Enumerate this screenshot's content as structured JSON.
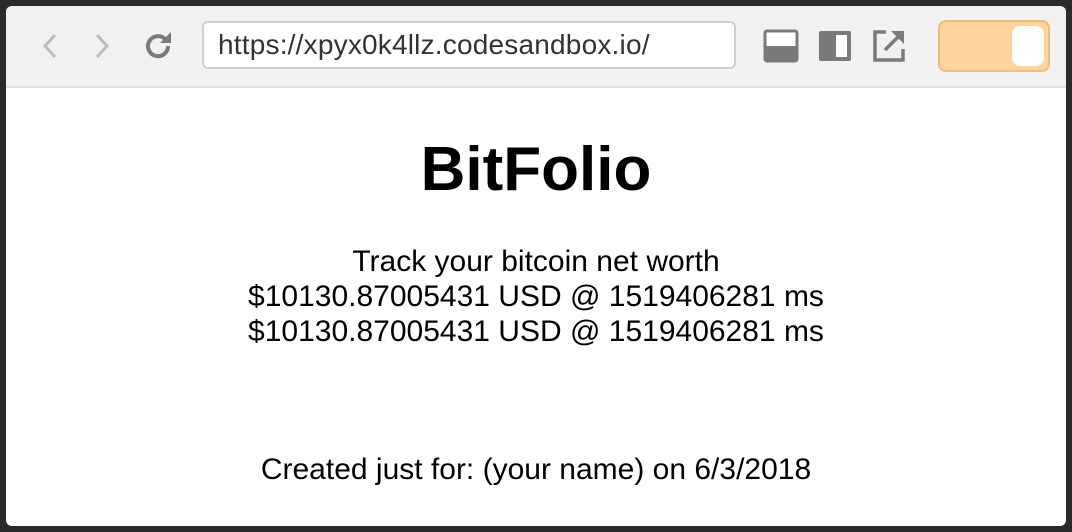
{
  "browser": {
    "url": "https://xpyx0k4llz.codesandbox.io/",
    "icons": {
      "back": "chevron-left-icon",
      "forward": "chevron-right-icon",
      "reload": "reload-icon",
      "layout_bottom": "layout-bottom-panel-icon",
      "layout_side": "layout-side-panel-icon",
      "open_external": "open-external-icon"
    },
    "toggle": {
      "state": "on",
      "color": "#fdd49e"
    }
  },
  "page": {
    "title": "BitFolio",
    "subtitle": "Track your bitcoin net worth",
    "prices": [
      "$10130.87005431 USD @ 1519406281 ms",
      "$10130.87005431 USD @ 1519406281 ms"
    ],
    "footer": "Created just for: (your name) on 6/3/2018"
  }
}
